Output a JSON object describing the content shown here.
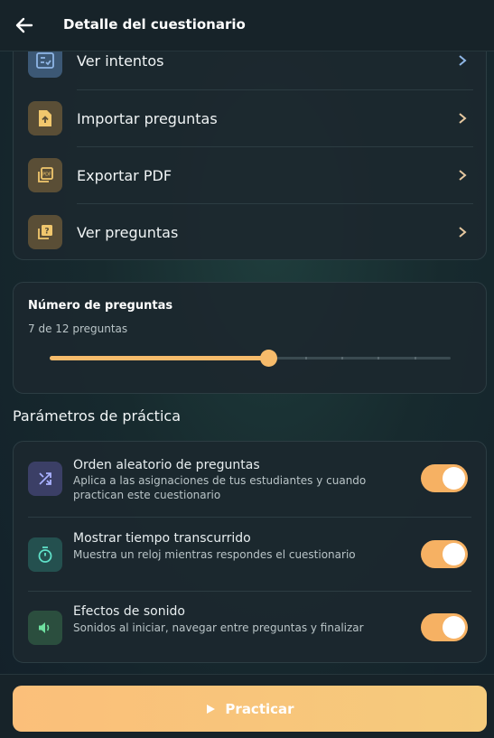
{
  "header": {
    "title": "Detalle del cuestionario",
    "back_icon": "arrow-left-icon"
  },
  "menu": {
    "items": [
      {
        "label": "Ver intentos",
        "icon": "list-check-icon",
        "icon_bg": "#3c5875"
      },
      {
        "label": "Importar preguntas",
        "icon": "file-import-icon",
        "icon_bg": "#5a4e36"
      },
      {
        "label": "Exportar PDF",
        "icon": "pdf-icon",
        "icon_bg": "#5a4e36"
      },
      {
        "label": "Ver preguntas",
        "icon": "question-cards-icon",
        "icon_bg": "#5a4e36"
      }
    ]
  },
  "question_count": {
    "title": "Número de preguntas",
    "summary": "7 de 12 preguntas",
    "value": 7,
    "max": 12
  },
  "practice_params": {
    "section_title": "Parámetros de práctica",
    "items": [
      {
        "title": "Orden aleatorio de preguntas",
        "description": "Aplica a las asignaciones de tus estudiantes y cuando practican este cuestionario",
        "icon": "shuffle-icon",
        "enabled": true
      },
      {
        "title": "Mostrar tiempo transcurrido",
        "description": "Muestra un reloj mientras respondes el cuestionario",
        "icon": "stopwatch-icon",
        "enabled": true
      },
      {
        "title": "Efectos de sonido",
        "description": "Sonidos al iniciar, navegar entre preguntas y finalizar",
        "icon": "speaker-icon",
        "enabled": true
      }
    ]
  },
  "footer": {
    "practice_label": "Practicar",
    "practice_icon": "play-icon"
  },
  "colors": {
    "accent": "#f6bb6b",
    "toggle_on": "#f6b163",
    "card_bg": "#1c282e"
  }
}
